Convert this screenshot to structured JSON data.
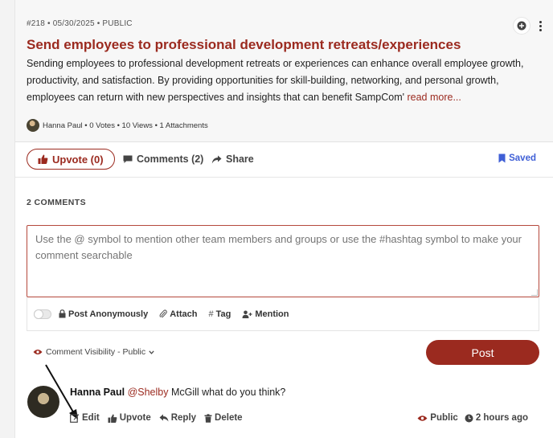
{
  "post": {
    "meta": "#218 • 05/30/2025 • PUBLIC",
    "title": "Send employees to professional development retreats/experiences",
    "description": "Sending employees to professional development retreats or experiences can enhance overall employee growth, productivity, and satisfaction. By providing opportunities for skill-building, networking, and personal growth, employees can return with new perspectives and insights that can benefit SampCom'",
    "read_more": "read more...",
    "author_line": "Hanna Paul • 0 Votes • 10 Views • 1 Attachments"
  },
  "actions": {
    "upvote": "Upvote (0)",
    "comments": "Comments (2)",
    "share": "Share",
    "saved": "Saved"
  },
  "comments_section": {
    "heading": "2 COMMENTS",
    "placeholder": "Use the @ symbol to mention other team members and groups or use the #hashtag symbol to make your comment searchable",
    "tools": {
      "anonymous": "Post Anonymously",
      "attach": "Attach",
      "tag": "Tag",
      "mention": "Mention"
    },
    "visibility": "Comment Visibility - Public",
    "post_button": "Post"
  },
  "comment": {
    "author": "Hanna Paul",
    "mention": "@Shelby",
    "text": " McGill what do you think?",
    "edit": "Edit",
    "upvote": "Upvote",
    "reply": "Reply",
    "delete": "Delete",
    "visibility": "Public",
    "time": "2 hours ago"
  },
  "colors": {
    "accent": "#9b2a1f",
    "saved": "#3f5fd6"
  }
}
